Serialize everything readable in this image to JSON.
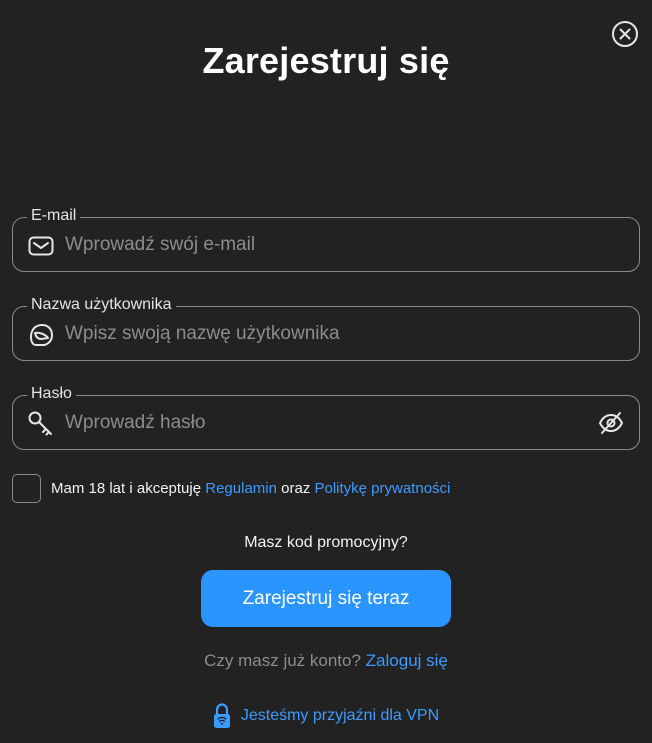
{
  "title": "Zarejestruj się",
  "close": {
    "icon": "close-icon"
  },
  "fields": {
    "email": {
      "label": "E-mail",
      "placeholder": "Wprowadź swój e-mail",
      "value": "",
      "icon": "envelope-icon"
    },
    "username": {
      "label": "Nazwa użytkownika",
      "placeholder": "Wpisz swoją nazwę użytkownika",
      "value": "",
      "icon": "helmet-icon"
    },
    "password": {
      "label": "Hasło",
      "placeholder": "Wprowadź hasło",
      "value": "",
      "icon": "key-icon",
      "toggle_icon": "eye-slash-icon"
    }
  },
  "terms": {
    "prefix": "Mam 18 lat i akceptuję ",
    "regulations_link": "Regulamin",
    "middle": " oraz ",
    "privacy_link": "Politykę prywatności",
    "checked": false
  },
  "promo": {
    "text": "Masz kod promocyjny?"
  },
  "submit": {
    "label": "Zarejestruj się teraz"
  },
  "login": {
    "prompt": "Czy masz już konto? ",
    "link": "Zaloguj się"
  },
  "vpn": {
    "text": "Jesteśmy przyjaźni dla VPN",
    "icon": "padlock-icon"
  },
  "colors": {
    "background": "#222223",
    "accent": "#2b95ff",
    "link": "#3c9bff",
    "border": "#8a8a8c",
    "placeholder": "#8c8c8e"
  }
}
